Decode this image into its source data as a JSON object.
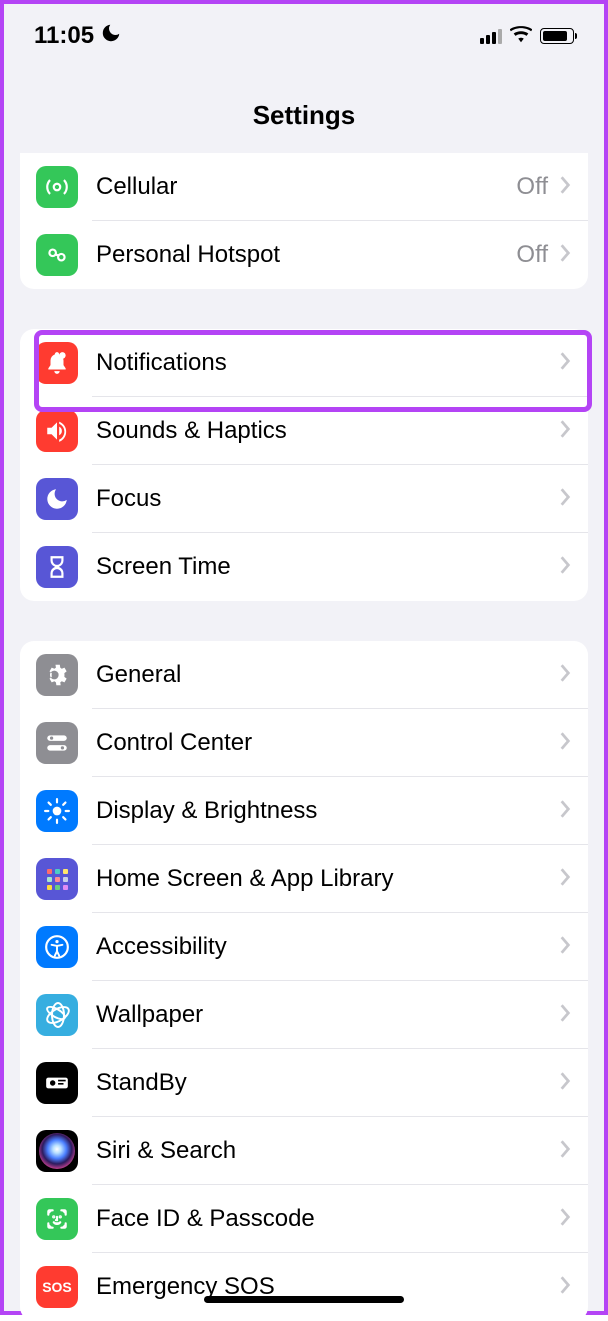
{
  "statusBar": {
    "time": "11:05"
  },
  "header": {
    "title": "Settings"
  },
  "groups": [
    {
      "rows": [
        {
          "label": "Cellular",
          "value": "Off"
        },
        {
          "label": "Personal Hotspot",
          "value": "Off"
        }
      ]
    },
    {
      "rows": [
        {
          "label": "Notifications"
        },
        {
          "label": "Sounds & Haptics"
        },
        {
          "label": "Focus"
        },
        {
          "label": "Screen Time"
        }
      ]
    },
    {
      "rows": [
        {
          "label": "General"
        },
        {
          "label": "Control Center"
        },
        {
          "label": "Display & Brightness"
        },
        {
          "label": "Home Screen & App Library"
        },
        {
          "label": "Accessibility"
        },
        {
          "label": "Wallpaper"
        },
        {
          "label": "StandBy"
        },
        {
          "label": "Siri & Search"
        },
        {
          "label": "Face ID & Passcode"
        },
        {
          "label": "Emergency SOS"
        }
      ]
    }
  ],
  "sosText": "SOS"
}
